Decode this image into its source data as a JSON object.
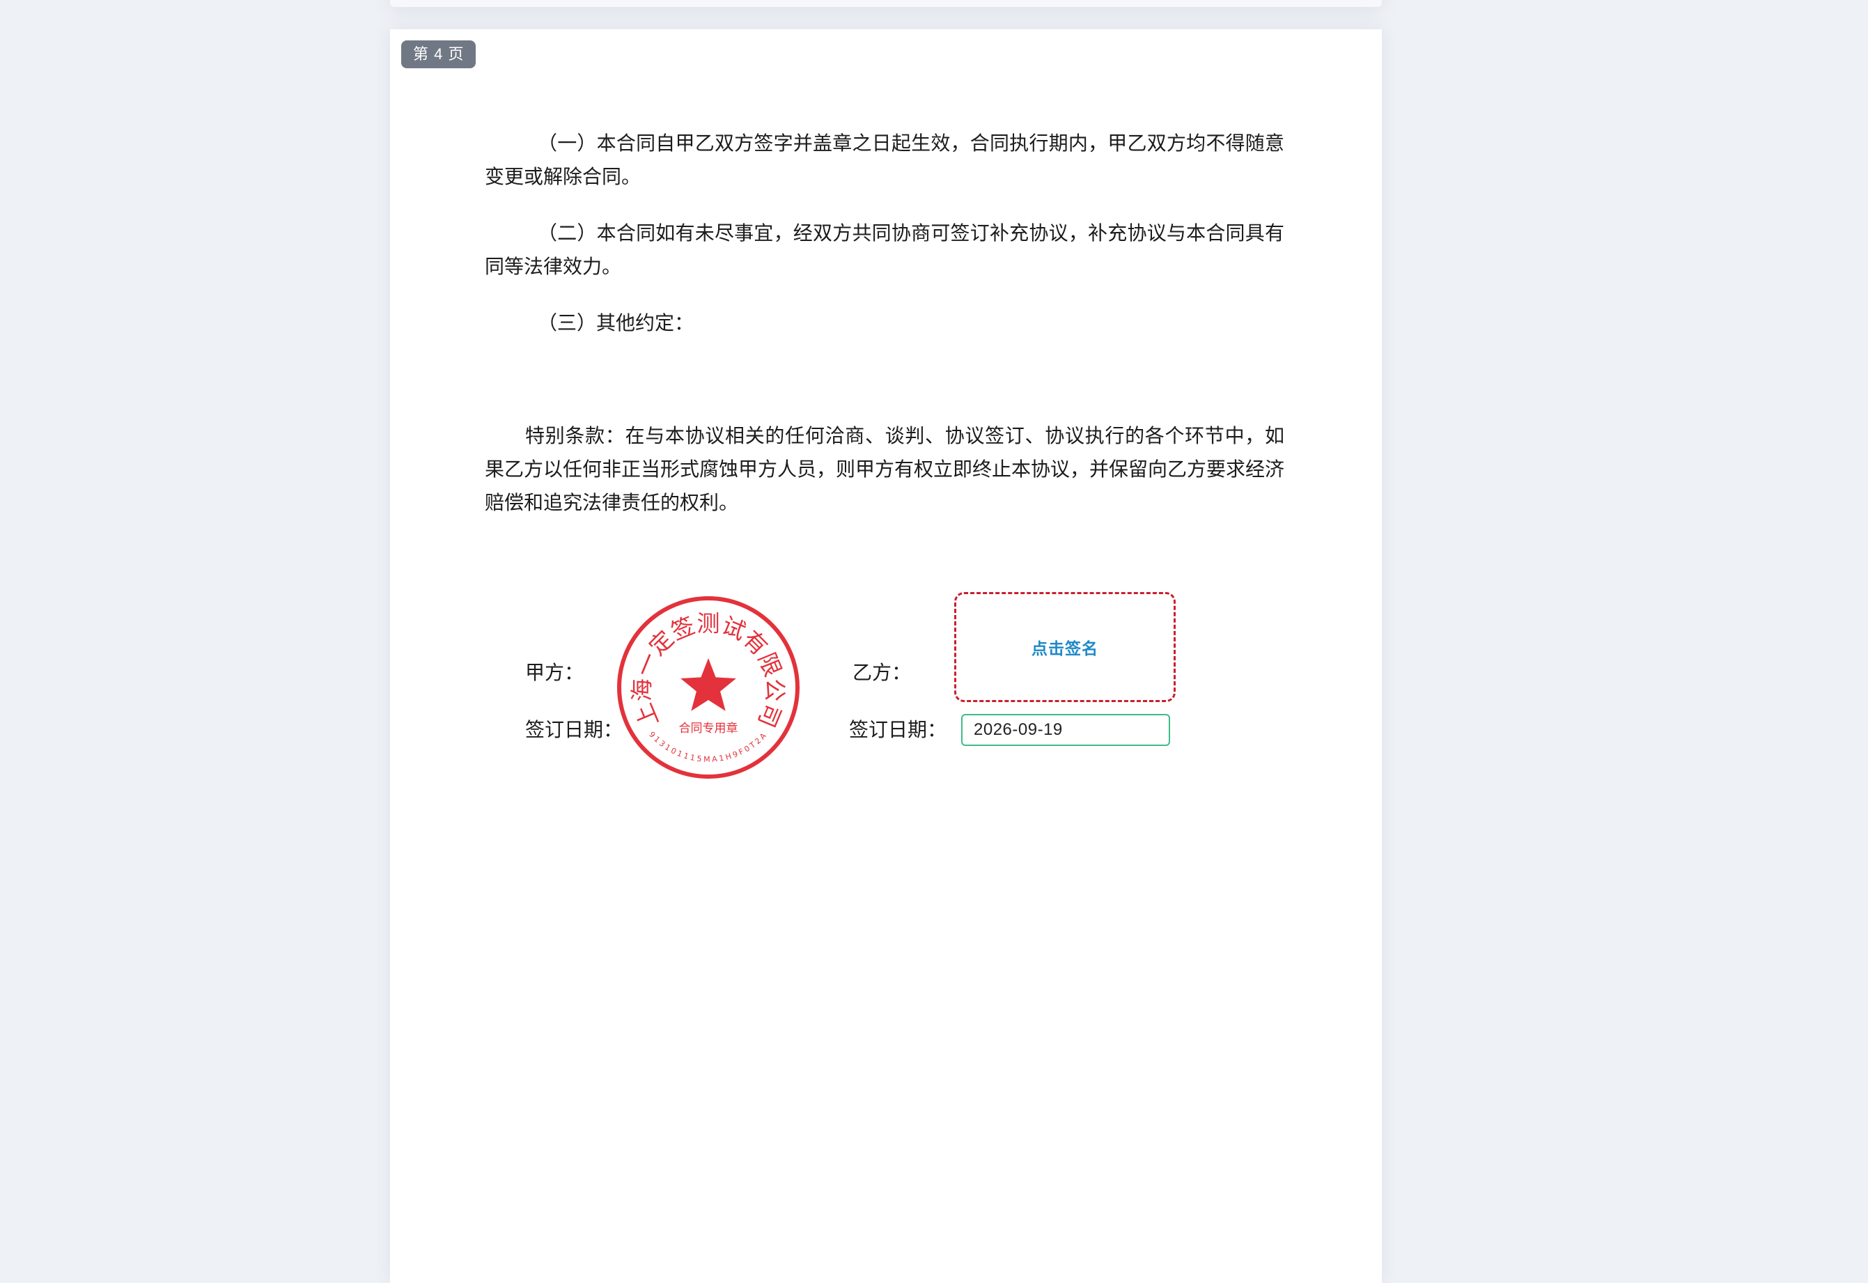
{
  "page": {
    "badge": "第 4 页"
  },
  "contract": {
    "clauses": [
      "（一）本合同自甲乙双方签字并盖章之日起生效，合同执行期内，甲乙双方均不得随意变更或解除合同。",
      "（二）本合同如有未尽事宜，经双方共同协商可签订补充协议，补充协议与本合同具有同等法律效力。",
      "（三）其他约定："
    ],
    "special_clause": "特别条款：在与本协议相关的任何洽商、谈判、协议签订、协议执行的各个环节中，如果乙方以任何非正当形式腐蚀甲方人员，则甲方有权立即终止本协议，并保留向乙方要求经济赔偿和追究法律责任的权利。"
  },
  "signature": {
    "party_a_label": "甲方：",
    "party_b_label": "乙方：",
    "party_a_date_label": "签订日期：",
    "party_b_date_label": "签订日期：",
    "sign_button": "点击签名",
    "date_value": "2026-09-19"
  },
  "seal": {
    "company": "上海一定签测试有限公司",
    "purpose": "合同专用章",
    "code": "913101115MA1H9F0T2A",
    "color": "#e3323b"
  }
}
